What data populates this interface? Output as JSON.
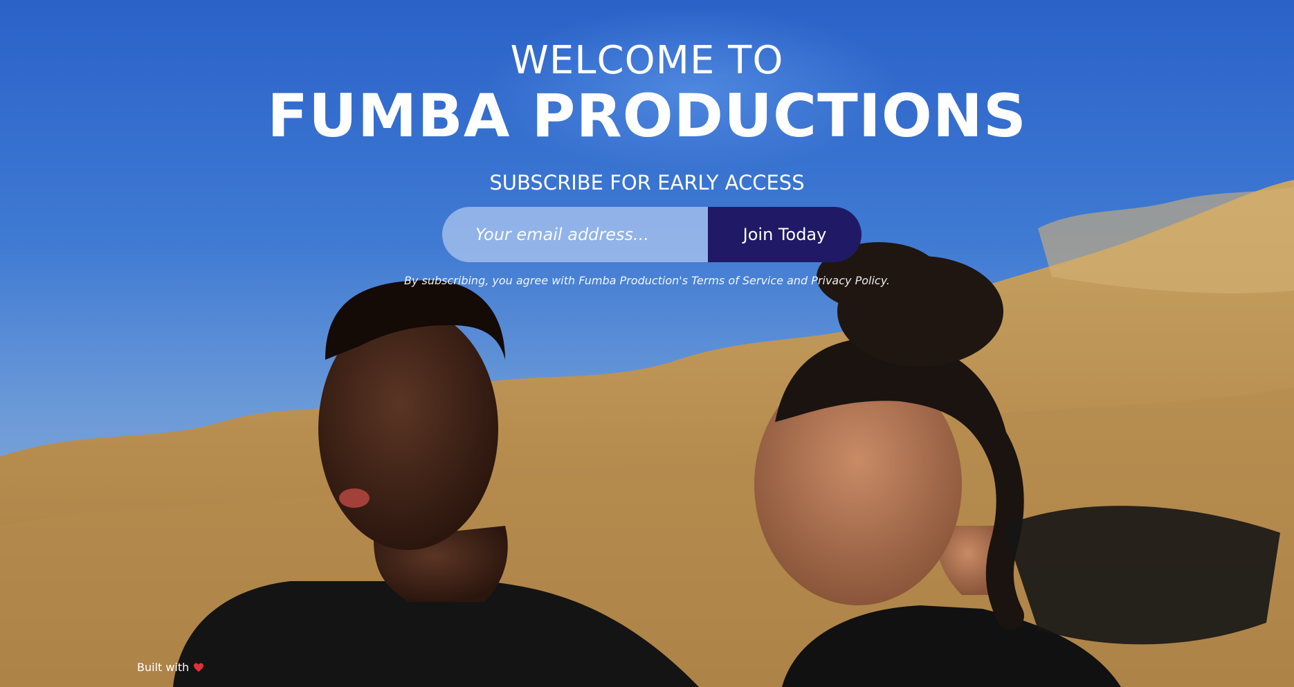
{
  "hero": {
    "welcome": "WELCOME TO",
    "brand": "FUMBA PRODUCTIONS",
    "subscribe_heading": "SUBSCRIBE FOR EARLY ACCESS"
  },
  "form": {
    "email_placeholder": "Your email address...",
    "email_value": "",
    "join_label": "Join Today"
  },
  "legal": {
    "text": "By subscribing, you agree with Fumba Production's Terms of Service and Privacy Policy."
  },
  "footer": {
    "built_with": "Built with",
    "heart_icon": "heart-icon"
  },
  "colors": {
    "sky": "#2f6ccc",
    "button": "#201a66",
    "input": "#b2c9f0",
    "sand": "#c49a57"
  }
}
